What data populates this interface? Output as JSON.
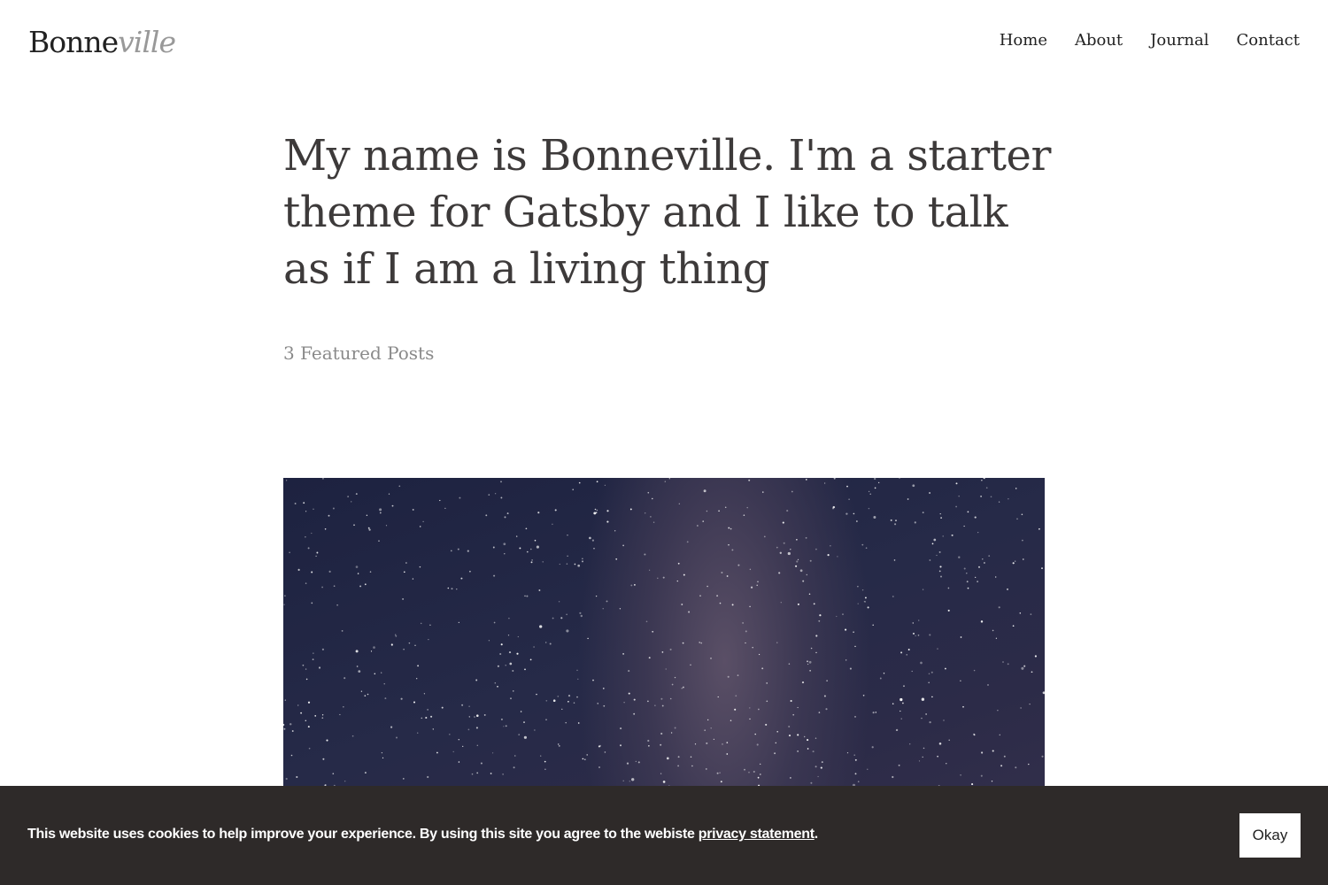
{
  "header": {
    "logo_part1": "Bonne",
    "logo_part2": "ville",
    "nav": [
      {
        "label": "Home"
      },
      {
        "label": "About"
      },
      {
        "label": "Journal"
      },
      {
        "label": "Contact"
      }
    ]
  },
  "intro": {
    "headline": "My name is Bonneville. I'm a starter theme for Gatsby and I like to talk as if I am a living thing",
    "featured_count": "3 Featured Posts"
  },
  "cookie": {
    "text": "This website uses cookies to help improve your experience. By using this site you agree to the webiste ",
    "link_label": "privacy statement",
    "period": ".",
    "button_label": "Okay"
  },
  "colors": {
    "cookie_bar_bg": "#2e2a29",
    "logo_accent": "#999999",
    "headline": "#3d3a3a"
  }
}
